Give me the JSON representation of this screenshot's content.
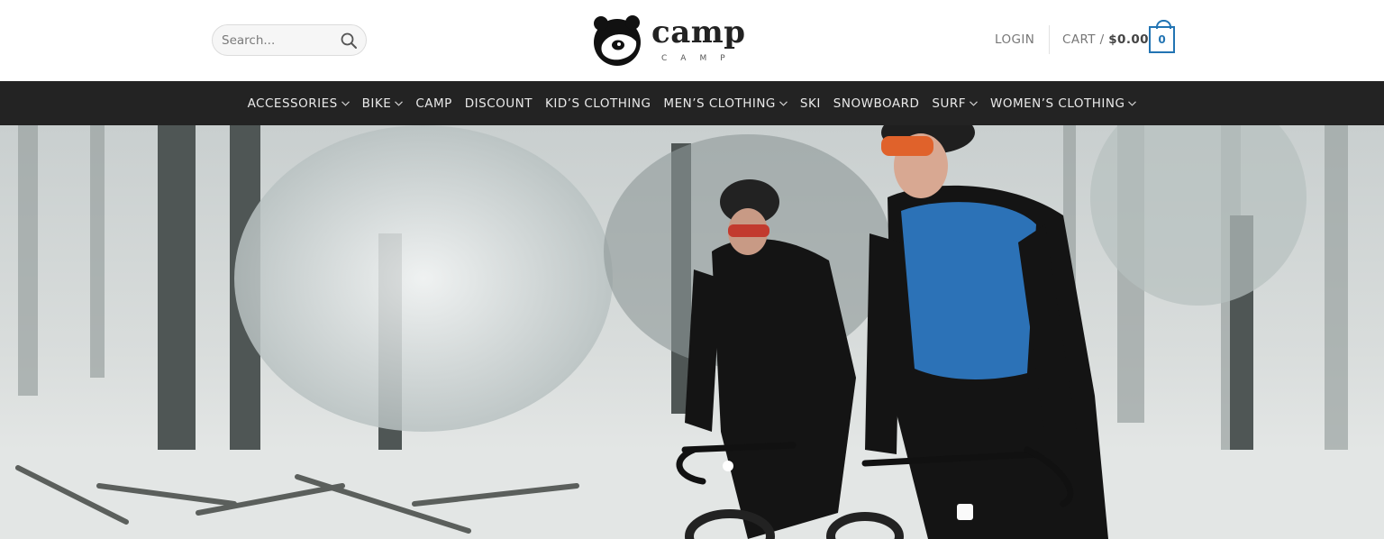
{
  "header": {
    "search": {
      "placeholder": "Search...",
      "icon": "search-icon"
    },
    "logo": {
      "word": "camp",
      "sub": "CAMP"
    },
    "login_label": "LOGIN",
    "cart": {
      "label": "CART /",
      "amount": "$0.00",
      "count": "0",
      "icon": "shopping-bag-icon",
      "accent": "#2274b3"
    }
  },
  "nav": {
    "items": [
      {
        "label": "ACCESSORIES",
        "dropdown": true
      },
      {
        "label": "BIKE",
        "dropdown": true
      },
      {
        "label": "CAMP",
        "dropdown": false
      },
      {
        "label": "DISCOUNT",
        "dropdown": false
      },
      {
        "label": "KID’S CLOTHING",
        "dropdown": false
      },
      {
        "label": "MEN’S CLOTHING",
        "dropdown": true
      },
      {
        "label": "SKI",
        "dropdown": false
      },
      {
        "label": "SNOWBOARD",
        "dropdown": false
      },
      {
        "label": "SURF",
        "dropdown": true
      },
      {
        "label": "WOMEN’S CLOTHING",
        "dropdown": true
      }
    ],
    "background": "#232323"
  },
  "hero": {
    "image": "two cyclists riding through snowy forest"
  }
}
